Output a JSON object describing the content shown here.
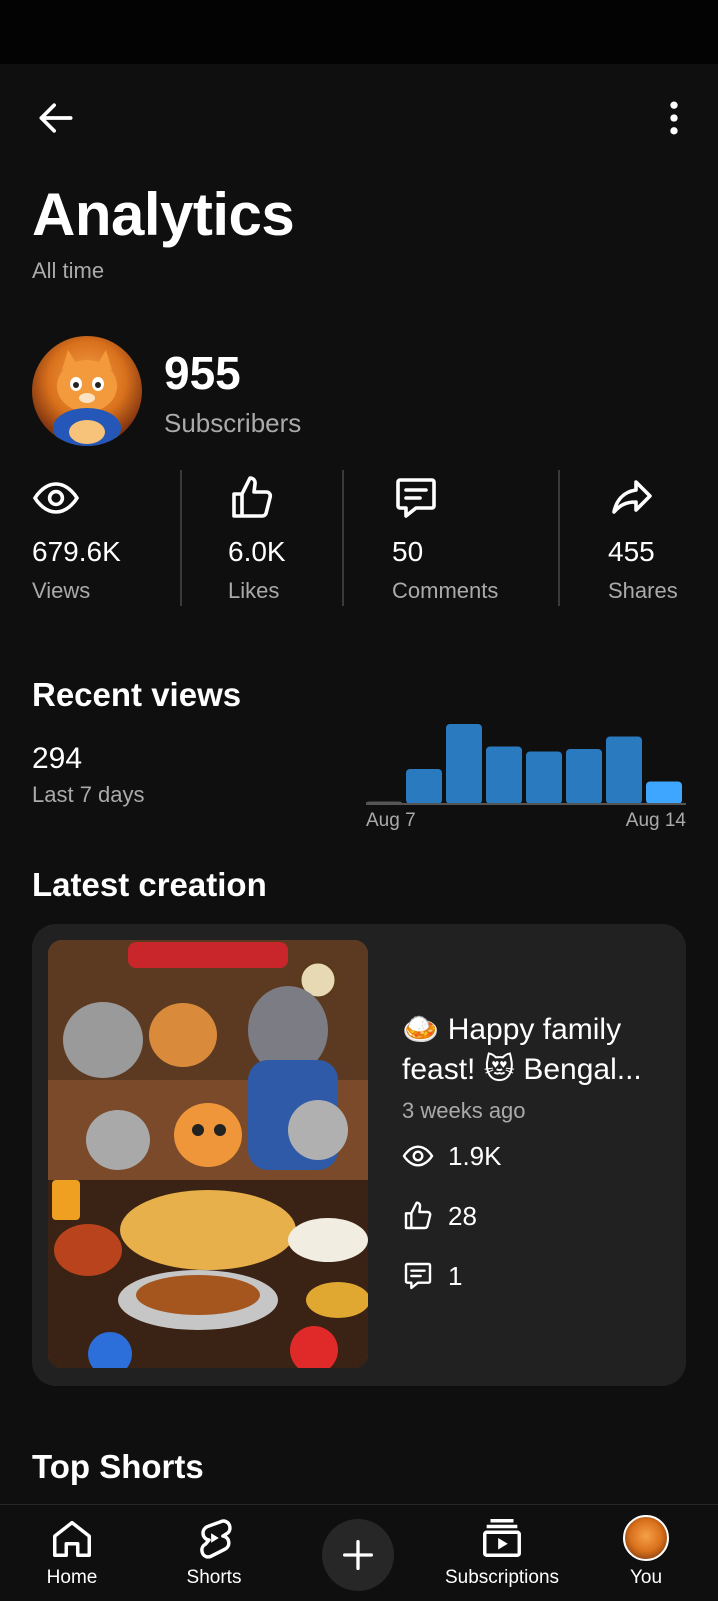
{
  "header": {
    "title": "Analytics",
    "subtitle": "All time"
  },
  "channel": {
    "subscribers_count": "955",
    "subscribers_label": "Subscribers"
  },
  "stats": [
    {
      "icon": "eye-icon",
      "value": "679.6K",
      "label": "Views"
    },
    {
      "icon": "thumbs-up-icon",
      "value": "6.0K",
      "label": "Likes"
    },
    {
      "icon": "comment-icon",
      "value": "50",
      "label": "Comments"
    },
    {
      "icon": "share-icon",
      "value": "455",
      "label": "Shares"
    }
  ],
  "recent_views": {
    "title": "Recent views",
    "value": "294",
    "period": "Last 7 days",
    "x_start": "Aug 7",
    "x_end": "Aug 14"
  },
  "chart_data": {
    "type": "bar",
    "categories": [
      "Aug 7",
      "Aug 8",
      "Aug 9",
      "Aug 10",
      "Aug 11",
      "Aug 12",
      "Aug 13",
      "Aug 14"
    ],
    "values": [
      1,
      14,
      32,
      23,
      21,
      22,
      27,
      9
    ],
    "highlight_last": true,
    "colors": {
      "bar": "#2a7ac0",
      "bar_current": "#3ea6ff",
      "baseline": "#555555"
    }
  },
  "latest": {
    "title": "Latest creation",
    "video_title_line1": "🍛 Happy family",
    "video_title_line2": "feast! 😻 Bengal...",
    "age": "3 weeks ago",
    "views": "1.9K",
    "likes": "28",
    "comments": "1"
  },
  "top_shorts": {
    "title": "Top Shorts"
  },
  "nav": {
    "home": "Home",
    "shorts": "Shorts",
    "subscriptions": "Subscriptions",
    "you": "You"
  }
}
